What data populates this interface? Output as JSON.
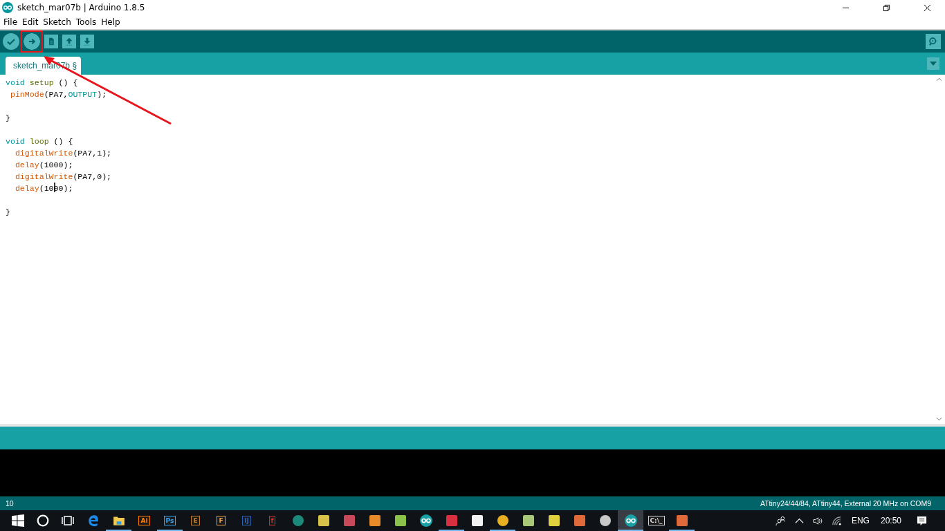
{
  "window": {
    "title": "sketch_mar07b | Arduino 1.8.5"
  },
  "menu": [
    "File",
    "Edit",
    "Sketch",
    "Tools",
    "Help"
  ],
  "toolbar": [
    {
      "kind": "verify",
      "highlighted": false
    },
    {
      "kind": "upload",
      "highlighted": true
    },
    {
      "kind": "new",
      "highlighted": false
    },
    {
      "kind": "open",
      "highlighted": false
    },
    {
      "kind": "save",
      "highlighted": false
    }
  ],
  "tabs": [
    {
      "label": "sketch_mar07b §",
      "selected": true
    }
  ],
  "code": [
    [
      {
        "kind": "keyword",
        "text": "void"
      },
      {
        "kind": "function",
        "text": "setup",
        "gap": true
      },
      {
        "kind": "plain",
        "text": "() {",
        "gap": true
      }
    ],
    [
      {
        "kind": "builtin",
        "text": "pinMode",
        "gap": true
      },
      {
        "kind": "plain",
        "text": "(PA7,"
      },
      {
        "kind": "constant",
        "text": "OUTPUT"
      },
      {
        "kind": "plain",
        "text": ");"
      }
    ],
    [
      {
        "kind": "blank"
      }
    ],
    [
      {
        "kind": "plain",
        "text": "}"
      }
    ],
    [
      {
        "kind": "blank"
      }
    ],
    [
      {
        "kind": "keyword",
        "text": "void"
      },
      {
        "kind": "function",
        "text": "loop",
        "gap": true
      },
      {
        "kind": "plain",
        "text": "() {",
        "gap": true
      }
    ],
    [
      {
        "kind": "builtin",
        "text": "digitalWrite",
        "indent": true
      },
      {
        "kind": "plain",
        "text": "(PA7,1);"
      }
    ],
    [
      {
        "kind": "builtin",
        "text": "delay",
        "indent": true
      },
      {
        "kind": "plain",
        "text": "(1000);"
      }
    ],
    [
      {
        "kind": "builtin",
        "text": "digitalWrite",
        "indent": true
      },
      {
        "kind": "plain",
        "text": "(PA7,0);"
      }
    ],
    [
      {
        "kind": "builtin",
        "text": "delay",
        "indent": true
      },
      {
        "kind": "plain",
        "text": "(10"
      },
      {
        "kind": "cursor"
      },
      {
        "kind": "plain",
        "text": "00);"
      }
    ],
    [
      {
        "kind": "blank"
      }
    ],
    [
      {
        "kind": "plain",
        "text": "}"
      }
    ]
  ],
  "annotations": [
    {
      "kind": "arrow"
    }
  ],
  "status_bar": {
    "line": "10",
    "board": "ATtiny24/44/84, ATtiny44, External 20 MHz on COM9"
  },
  "taskbar": {
    "apps": [
      {
        "kind": "edge",
        "running": false,
        "active": false
      },
      {
        "kind": "folder",
        "running": true,
        "active": false
      },
      {
        "kind": "letter",
        "label": "Ai",
        "color": "#ff7c00",
        "running": false,
        "active": false
      },
      {
        "kind": "letter",
        "label": "Ps",
        "color": "#31a8ff",
        "running": true,
        "active": false
      },
      {
        "kind": "letter",
        "label": "E",
        "color": "#c07a2a",
        "running": false,
        "active": false
      },
      {
        "kind": "letter",
        "label": "F",
        "color": "#e8a04a",
        "running": false,
        "active": false
      },
      {
        "kind": "letter",
        "label": "IJ",
        "color": "#2b5fb3",
        "running": false,
        "active": false
      },
      {
        "kind": "letter",
        "label": "f",
        "color": "#d42a2a",
        "running": false,
        "active": false
      },
      {
        "kind": "circle",
        "color": "#1c8a7a",
        "running": false,
        "active": false
      },
      {
        "kind": "square",
        "color": "#d8c24a",
        "running": false,
        "active": false
      },
      {
        "kind": "square",
        "color": "#c84a5a",
        "running": false,
        "active": false
      },
      {
        "kind": "square",
        "color": "#e8892a",
        "running": false,
        "active": false
      },
      {
        "kind": "square",
        "color": "#8ac24a",
        "running": false,
        "active": false
      },
      {
        "kind": "arduino",
        "color": "#19a0a5",
        "running": false,
        "active": false
      },
      {
        "kind": "square",
        "color": "#d83040",
        "running": true,
        "active": false
      },
      {
        "kind": "square",
        "color": "#f2f2f2",
        "running": false,
        "active": false
      },
      {
        "kind": "circle",
        "color": "#e8b020",
        "running": true,
        "active": false
      },
      {
        "kind": "square",
        "color": "#a8c878",
        "running": false,
        "active": false
      },
      {
        "kind": "square",
        "color": "#e0d040",
        "running": false,
        "active": false
      },
      {
        "kind": "square",
        "color": "#e06a3a",
        "running": false,
        "active": false
      },
      {
        "kind": "circle",
        "color": "#c8c8c8",
        "running": false,
        "active": false
      },
      {
        "kind": "arduino",
        "color": "#19a0a5",
        "running": true,
        "active": true
      },
      {
        "kind": "letter",
        "label": "C:\\_",
        "color": "#d8d8d8",
        "running": false,
        "active": false
      },
      {
        "kind": "square",
        "color": "#e06a3a",
        "running": true,
        "active": false
      }
    ],
    "language": "ENG",
    "time": "20:50"
  }
}
